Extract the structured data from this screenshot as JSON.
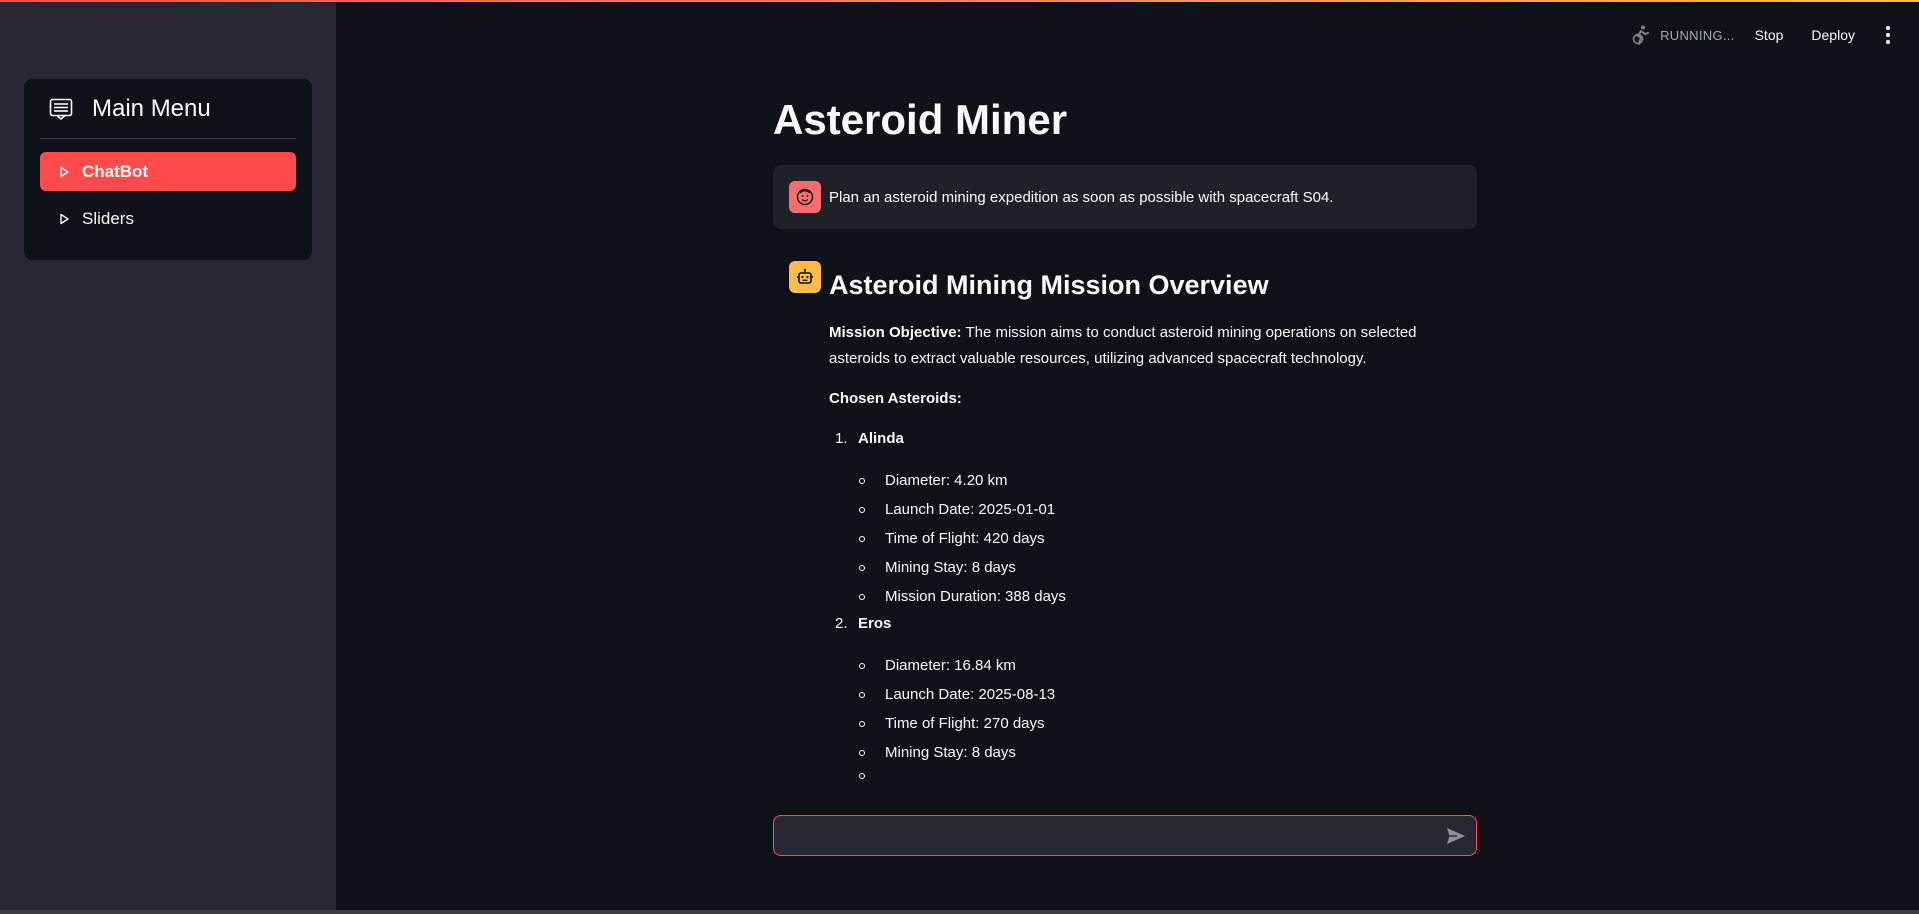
{
  "sidebar": {
    "menu_title": "Main Menu",
    "menu_icon": "menu-list-icon",
    "items": [
      {
        "label": "ChatBot",
        "active": true
      },
      {
        "label": "Sliders",
        "active": false
      }
    ]
  },
  "toolbar": {
    "status": "RUNNING...",
    "stop_label": "Stop",
    "deploy_label": "Deploy"
  },
  "main": {
    "title": "Asteroid Miner",
    "user_message": "Plan an asteroid mining expedition as soon as possible with spacecraft S04.",
    "bot": {
      "heading": "Asteroid Mining Mission Overview",
      "objective_label": "Mission Objective:",
      "objective_text": " The mission aims to conduct asteroid mining operations on selected asteroids to extract valuable resources, utilizing advanced spacecraft technology.",
      "chosen_label": "Chosen Asteroids:",
      "asteroids": [
        {
          "num": "1.",
          "name": "Alinda",
          "details": [
            "Diameter: 4.20 km",
            "Launch Date: 2025-01-01",
            "Time of Flight: 420 days",
            "Mining Stay: 8 days",
            "Mission Duration: 388 days"
          ]
        },
        {
          "num": "2.",
          "name": "Eros",
          "details": [
            "Diameter: 16.84 km",
            "Launch Date: 2025-08-13",
            "Time of Flight: 270 days",
            "Mining Stay: 8 days",
            ""
          ]
        }
      ]
    },
    "chat_input": {
      "value": "",
      "placeholder": ""
    }
  },
  "colors": {
    "accent": "#ff4b4b",
    "bot_avatar": "#ffbd45",
    "background": "#0e1117",
    "sidebar": "#262730"
  }
}
